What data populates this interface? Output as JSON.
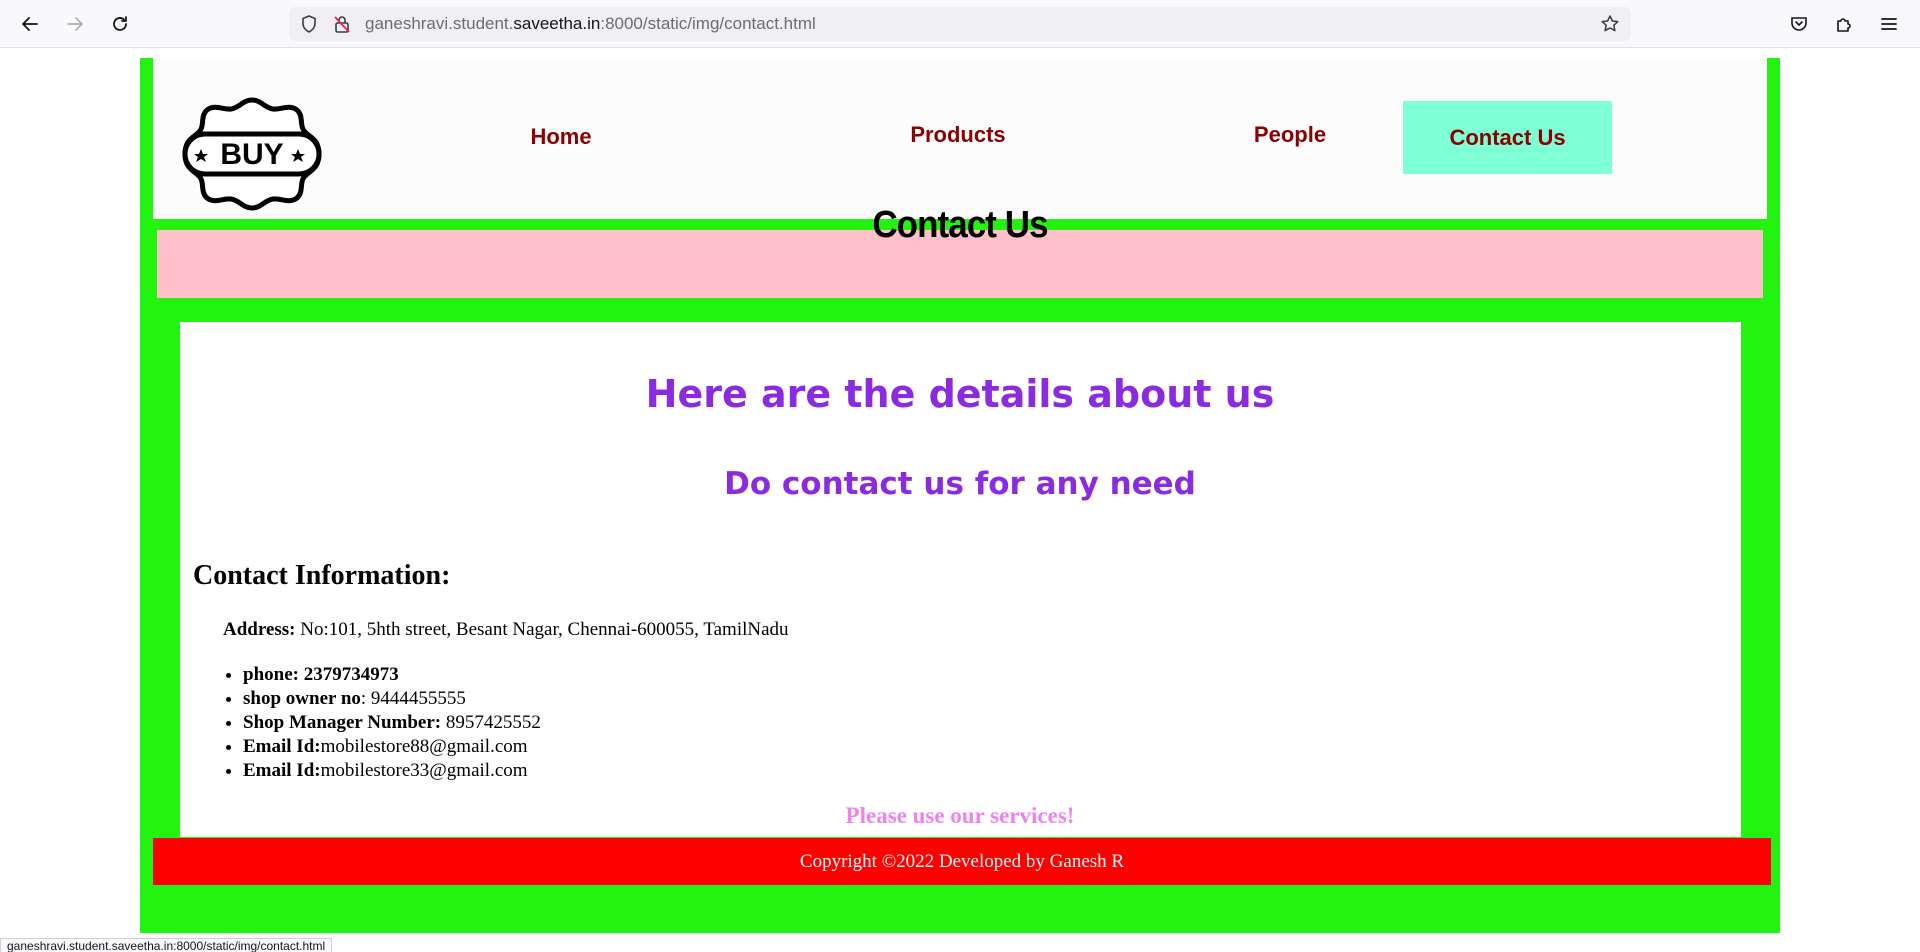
{
  "browser": {
    "url_prefix": "ganeshravi.student.",
    "url_host": "saveetha.in",
    "url_suffix": ":8000/static/img/contact.html",
    "status_url": "ganeshravi.student.saveetha.in:8000/static/img/contact.html"
  },
  "logo": {
    "text": "BUY"
  },
  "nav": {
    "home": "Home",
    "products": "Products",
    "people": "People",
    "contact": "Contact Us"
  },
  "banner": {
    "title": "Contact Us"
  },
  "content": {
    "heading": "Here are the details about us",
    "subheading": "Do contact us for any need",
    "info_title": "Contact Information:",
    "address_label": "Address:",
    "address_value": " No:101, 5hth street, Besant Nagar, Chennai-600055, TamilNadu",
    "items": [
      {
        "label": "phone: 2379734973",
        "value": ""
      },
      {
        "label": "shop owner no",
        "value": ": 9444455555"
      },
      {
        "label": "Shop Manager Number:",
        "value": " 8957425552"
      },
      {
        "label": "Email Id:",
        "value": "mobilestore88@gmail.com"
      },
      {
        "label": "Email Id:",
        "value": "mobilestore33@gmail.com"
      }
    ],
    "closing": "Please use our services!"
  },
  "footer": {
    "text": "Copyright ©2022 Developed by Ganesh R"
  },
  "colors": {
    "page_bg": "#24f312",
    "banner_bg": "#ffc0cb",
    "nav_text": "#8b0000",
    "nav_active_bg": "#7fffd4",
    "heading": "#8a2be2",
    "closing": "#ee82ee",
    "footer_bg": "#ff0000"
  },
  "icons": [
    "back-arrow-icon",
    "forward-arrow-icon",
    "reload-icon",
    "shield-icon",
    "insecure-lock-icon",
    "star-icon",
    "pocket-icon",
    "extensions-icon",
    "menu-icon"
  ]
}
